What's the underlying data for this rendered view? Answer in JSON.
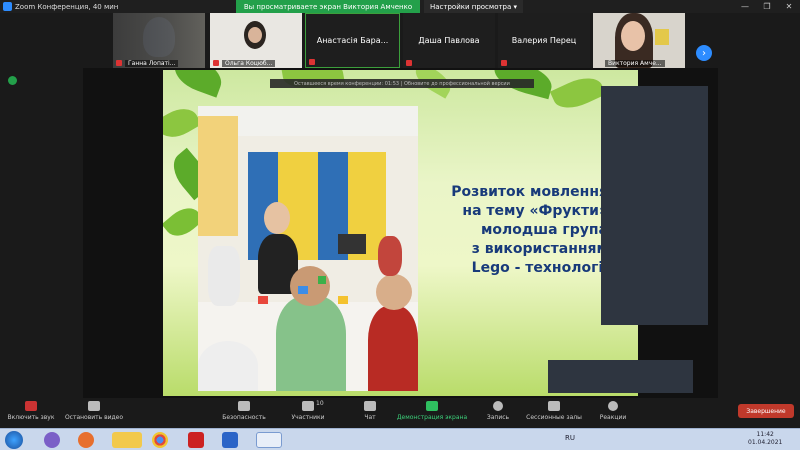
{
  "window": {
    "title": "Zoom Конференция, 40 мин",
    "banner": "Вы просматриваете экран Виктория Амченко",
    "view_options": "Настройки просмотра ▾",
    "controls": [
      "—",
      "❐",
      "✕"
    ]
  },
  "gallery": {
    "participants": [
      {
        "name": "Ганна Лопаті..."
      },
      {
        "name": "Ольга Коцюб..."
      },
      {
        "name": "Анастасія Бара..."
      },
      {
        "name": "Даша Павлова"
      },
      {
        "name": "Валерия Перец"
      },
      {
        "name": "Виктория Амче..."
      }
    ],
    "next_arrow": "›"
  },
  "notice": "Оставшееся время конференции: 01:53 | Обновите до профессиональной версии",
  "slide": {
    "title_lines": [
      "Розвиток мовлення",
      "на тему «Фрукти»",
      "молодша група",
      "з використанням",
      "Lego - технології"
    ]
  },
  "toolbar": {
    "items": [
      {
        "label": "Включить звук",
        "icon": "microphone-muted-icon"
      },
      {
        "label": "Остановить видео",
        "icon": "video-camera-icon"
      },
      {
        "label": "Безопасность",
        "icon": "shield-icon"
      },
      {
        "label": "Участники",
        "icon": "participants-icon",
        "count": "10"
      },
      {
        "label": "Чат",
        "icon": "chat-icon"
      },
      {
        "label": "Демонстрация экрана",
        "icon": "share-screen-icon"
      },
      {
        "label": "Запись",
        "icon": "record-icon"
      },
      {
        "label": "Сессионные залы",
        "icon": "breakout-rooms-icon"
      },
      {
        "label": "Реакции",
        "icon": "reactions-icon"
      }
    ],
    "end_label": "Завершение"
  },
  "taskbar": {
    "lang": "RU",
    "time": "11:42",
    "date": "01.04.2021"
  },
  "colors": {
    "zoom_blue": "#2d8cff",
    "banner_green": "#23a04a",
    "end_red": "#c0392b",
    "slide_text": "#183a7a"
  }
}
